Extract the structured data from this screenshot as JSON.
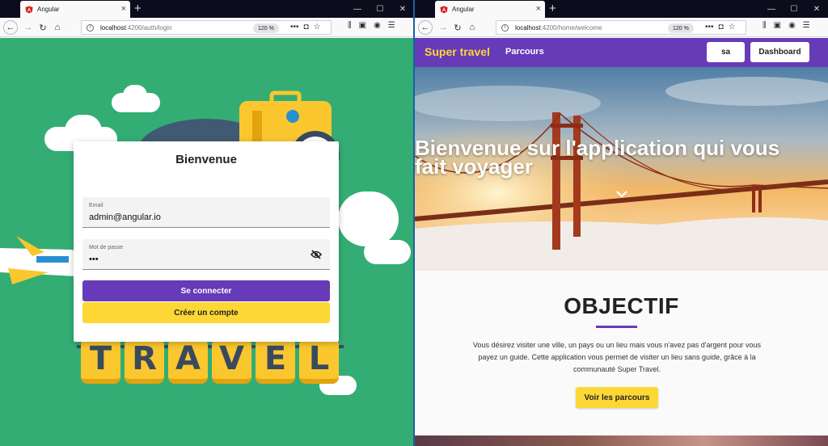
{
  "left": {
    "tab_title": "Angular",
    "url_host": "localhost",
    "url_path": ":4200/auth/login",
    "zoom": "120 %",
    "card": {
      "title": "Bienvenue",
      "email_label": "Email",
      "email_value": "admin@angular.io",
      "password_label": "Mot de passe",
      "password_value": "•••",
      "login_button": "Se connecter",
      "create_button": "Créer un compte"
    },
    "background_letters": [
      "T",
      "R",
      "A",
      "V",
      "E",
      "L"
    ]
  },
  "right": {
    "tab_title": "Angular",
    "url_host": "localhost",
    "url_path": ":4200/home/welcome",
    "zoom": "120 %",
    "brand": "Super travel",
    "nav_link": "Parcours",
    "user_button": "sa",
    "dashboard_button": "Dashboard",
    "hero_title": "Bienvenue sur l'application qui vous fait voyager",
    "section_title": "OBJECTIF",
    "section_text": "Vous désirez visiter une ville, un pays ou un lieu mais vous n'avez pas d'argent pour vous payez un guide. Cette application vous permet de visiter un lieu sans guide, grâce à la communauté Super Travel.",
    "cta_button": "Voir les parcours"
  },
  "colors": {
    "primary": "#673ab7",
    "accent": "#fdd835",
    "left_background": "#33ad74"
  }
}
